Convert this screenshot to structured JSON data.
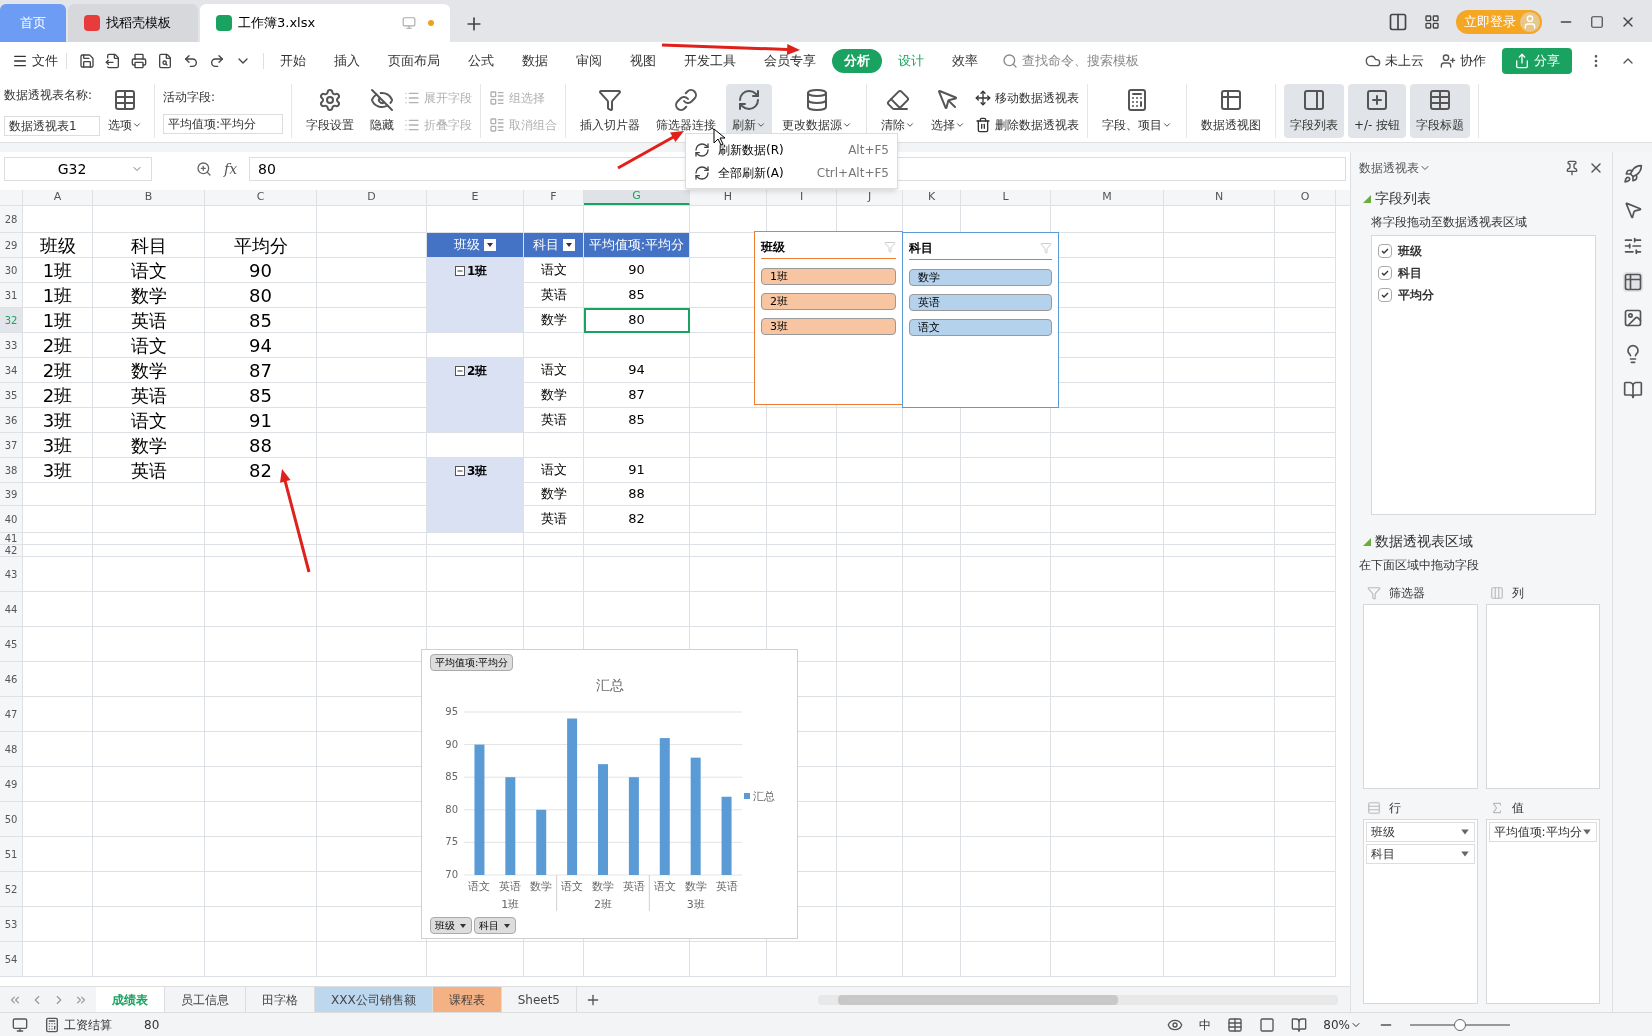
{
  "tabs": [
    {
      "label": "首页",
      "selected": false,
      "kind": "home"
    },
    {
      "label": "找稻壳模板",
      "selected": false,
      "kind": "docer"
    },
    {
      "label": "工作簿3.xlsx",
      "selected": true,
      "kind": "sheet"
    }
  ],
  "title_bar": {
    "login": "立即登录"
  },
  "menu": {
    "file": "文件",
    "items": [
      {
        "label": "开始",
        "selected": false,
        "kind": "normal"
      },
      {
        "label": "插入",
        "selected": false,
        "kind": "normal"
      },
      {
        "label": "页面布局",
        "selected": false,
        "kind": "normal"
      },
      {
        "label": "公式",
        "selected": false,
        "kind": "normal"
      },
      {
        "label": "数据",
        "selected": false,
        "kind": "normal"
      },
      {
        "label": "审阅",
        "selected": false,
        "kind": "normal"
      },
      {
        "label": "视图",
        "selected": false,
        "kind": "normal"
      },
      {
        "label": "开发工具",
        "selected": false,
        "kind": "normal"
      },
      {
        "label": "会员专享",
        "selected": false,
        "kind": "normal"
      },
      {
        "label": "分析",
        "selected": true,
        "kind": "context"
      },
      {
        "label": "设计",
        "selected": false,
        "kind": "context"
      },
      {
        "label": "效率",
        "selected": false,
        "kind": "normal"
      }
    ],
    "search": {
      "placeholder": "查找命令、搜索模板"
    },
    "cloud": "未上云",
    "collab": "协作",
    "share": "分享"
  },
  "ribbon": {
    "name_label": "数据透视表名称:",
    "name_value": "数据透视表1",
    "options": "选项",
    "field_label": "活动字段:",
    "field_value": "平均值项:平均分",
    "groups": [
      {
        "controls": [
          {
            "kind": "large",
            "label": "字段设置",
            "dropdown": false,
            "disabled": false,
            "on": false
          },
          {
            "kind": "large",
            "label": "隐藏",
            "dropdown": false,
            "disabled": false,
            "on": false
          },
          {
            "kind": "stack",
            "items": [
              {
                "label": "展开字段",
                "disabled": true
              },
              {
                "label": "折叠字段",
                "disabled": true
              }
            ]
          }
        ]
      },
      {
        "controls": [
          {
            "kind": "stack",
            "items": [
              {
                "label": "组选择",
                "disabled": true
              },
              {
                "label": "取消组合",
                "disabled": true
              }
            ]
          }
        ]
      },
      {
        "controls": [
          {
            "kind": "large",
            "label": "插入切片器",
            "dropdown": false,
            "disabled": false,
            "on": false
          },
          {
            "kind": "large",
            "label": "筛选器连接",
            "dropdown": false,
            "disabled": false,
            "on": false
          },
          {
            "kind": "large",
            "label": "刷新",
            "dropdown": true,
            "disabled": false,
            "on": true
          },
          {
            "kind": "large",
            "label": "更改数据源",
            "dropdown": true,
            "disabled": false,
            "on": false
          }
        ]
      },
      {
        "controls": [
          {
            "kind": "large",
            "label": "清除",
            "dropdown": true,
            "disabled": false,
            "on": false
          },
          {
            "kind": "large",
            "label": "选择",
            "dropdown": true,
            "disabled": false,
            "on": false
          },
          {
            "kind": "stack",
            "items": [
              {
                "label": "移动数据透视表",
                "disabled": false
              },
              {
                "label": "删除数据透视表",
                "disabled": false
              }
            ]
          }
        ]
      },
      {
        "controls": [
          {
            "kind": "large",
            "label": "字段、项目",
            "dropdown": true,
            "disabled": false,
            "on": false
          }
        ]
      },
      {
        "controls": [
          {
            "kind": "large",
            "label": "数据透视图",
            "dropdown": false,
            "disabled": false,
            "on": false
          }
        ]
      },
      {
        "controls": [
          {
            "kind": "large",
            "label": "字段列表",
            "dropdown": false,
            "disabled": false,
            "on": true
          },
          {
            "kind": "large",
            "label": "+/- 按钮",
            "dropdown": false,
            "disabled": false,
            "on": true
          },
          {
            "kind": "large",
            "label": "字段标题",
            "dropdown": false,
            "disabled": false,
            "on": true
          }
        ]
      }
    ]
  },
  "refresh_menu": [
    {
      "label": "刷新数据(R)",
      "shortcut": "Alt+F5"
    },
    {
      "label": "全部刷新(A)",
      "shortcut": "Ctrl+Alt+F5"
    }
  ],
  "formula_bar": {
    "cell": "G32",
    "fx": "fx",
    "value": "80"
  },
  "columns": [
    {
      "label": "A",
      "selected": false
    },
    {
      "label": "B",
      "selected": false
    },
    {
      "label": "C",
      "selected": false
    },
    {
      "label": "D",
      "selected": false
    },
    {
      "label": "E",
      "selected": false
    },
    {
      "label": "F",
      "selected": false
    },
    {
      "label": "G",
      "selected": true
    },
    {
      "label": "H",
      "selected": false
    },
    {
      "label": "I",
      "selected": false
    },
    {
      "label": "J",
      "selected": false
    },
    {
      "label": "K",
      "selected": false
    },
    {
      "label": "L",
      "selected": false
    },
    {
      "label": "M",
      "selected": false
    },
    {
      "label": "N",
      "selected": false
    },
    {
      "label": "O",
      "selected": false
    }
  ],
  "rows": [
    {
      "label": "28",
      "selected": false
    },
    {
      "label": "29",
      "selected": false
    },
    {
      "label": "30",
      "selected": false
    },
    {
      "label": "31",
      "selected": false
    },
    {
      "label": "32",
      "selected": true
    },
    {
      "label": "33",
      "selected": false
    },
    {
      "label": "34",
      "selected": false
    },
    {
      "label": "35",
      "selected": false
    },
    {
      "label": "36",
      "selected": false
    },
    {
      "label": "37",
      "selected": false
    },
    {
      "label": "38",
      "selected": false
    },
    {
      "label": "39",
      "selected": false
    },
    {
      "label": "40",
      "selected": false
    },
    {
      "label": "41",
      "selected": false
    },
    {
      "label": "42",
      "selected": false
    },
    {
      "label": "43",
      "selected": false
    },
    {
      "label": "44",
      "selected": false
    },
    {
      "label": "45",
      "selected": false
    },
    {
      "label": "46",
      "selected": false
    },
    {
      "label": "47",
      "selected": false
    },
    {
      "label": "48",
      "selected": false
    },
    {
      "label": "49",
      "selected": false
    },
    {
      "label": "50",
      "selected": false
    },
    {
      "label": "51",
      "selected": false
    },
    {
      "label": "52",
      "selected": false
    },
    {
      "label": "53",
      "selected": false
    },
    {
      "label": "54",
      "selected": false
    }
  ],
  "source_table": {
    "header": [
      "班级",
      "科目",
      "平均分"
    ],
    "rows": [
      [
        "1班",
        "语文",
        "90"
      ],
      [
        "1班",
        "数学",
        "80"
      ],
      [
        "1班",
        "英语",
        "85"
      ],
      [
        "2班",
        "语文",
        "94"
      ],
      [
        "2班",
        "数学",
        "87"
      ],
      [
        "2班",
        "英语",
        "85"
      ],
      [
        "3班",
        "语文",
        "91"
      ],
      [
        "3班",
        "数学",
        "88"
      ],
      [
        "3班",
        "英语",
        "82"
      ]
    ]
  },
  "pivot_table": {
    "headers": [
      {
        "label": "班级",
        "filter": true
      },
      {
        "label": "科目",
        "filter": true
      },
      {
        "label": "平均值项:平均分",
        "filter": false
      }
    ],
    "groups": [
      {
        "label": "1班",
        "expanded": true,
        "rows": [
          {
            "subject": "语文",
            "value": "90",
            "selected": false
          },
          {
            "subject": "英语",
            "value": "85",
            "selected": false
          },
          {
            "subject": "数学",
            "value": "80",
            "selected": true
          }
        ]
      },
      {
        "label": "2班",
        "expanded": true,
        "rows": [
          {
            "subject": "语文",
            "value": "94",
            "selected": false
          },
          {
            "subject": "数学",
            "value": "87",
            "selected": false
          },
          {
            "subject": "英语",
            "value": "85",
            "selected": false
          }
        ]
      },
      {
        "label": "3班",
        "expanded": true,
        "rows": [
          {
            "subject": "语文",
            "value": "91",
            "selected": false
          },
          {
            "subject": "数学",
            "value": "88",
            "selected": false
          },
          {
            "subject": "英语",
            "value": "82",
            "selected": false
          }
        ]
      }
    ]
  },
  "slicers": [
    {
      "title": "班级",
      "color": "#ed7d31",
      "items": [
        {
          "label": "1班",
          "selected": true
        },
        {
          "label": "2班",
          "selected": true
        },
        {
          "label": "3班",
          "selected": true
        }
      ]
    },
    {
      "title": "科目",
      "color": "#5b9bd5",
      "items": [
        {
          "label": "数学",
          "selected": true
        },
        {
          "label": "英语",
          "selected": true
        },
        {
          "label": "语文",
          "selected": true
        }
      ]
    }
  ],
  "chart": {
    "value_button": "平均值项:平均分",
    "axis_buttons": [
      "班级",
      "科目"
    ],
    "group_labels": [
      "1班",
      "2班",
      "3班"
    ],
    "chart_data": {
      "type": "bar",
      "title": "汇总",
      "categories": [
        "语文",
        "英语",
        "数学",
        "语文",
        "数学",
        "英语",
        "语文",
        "数学",
        "英语"
      ],
      "series": [
        {
          "name": "汇总",
          "color": "#5b9bd5",
          "values": [
            90,
            85,
            80,
            94,
            87,
            85,
            91,
            88,
            82
          ]
        }
      ],
      "ylim": [
        70,
        95
      ],
      "grid": true,
      "yticks": [
        70,
        75,
        80,
        85,
        90,
        95
      ]
    }
  },
  "sheet_tabs": [
    {
      "label": "成绩表",
      "selected": true
    },
    {
      "label": "员工信息",
      "selected": false
    },
    {
      "label": "田字格",
      "selected": false
    },
    {
      "label": "XXX公司销售额",
      "selected": false,
      "color": "#bdd7ee"
    },
    {
      "label": "课程表",
      "selected": false,
      "color": "#f4b183"
    },
    {
      "label": "Sheet5",
      "selected": false
    }
  ],
  "panel": {
    "title": "数据透视表",
    "fields_title": "字段列表",
    "fields_hint": "将字段拖动至数据透视表区域",
    "fields": [
      {
        "label": "班级",
        "checked": true
      },
      {
        "label": "科目",
        "checked": true
      },
      {
        "label": "平均分",
        "checked": true
      }
    ],
    "areas_title": "数据透视表区域",
    "areas_hint": "在下面区域中拖动字段",
    "areas": [
      {
        "label": "筛选器",
        "kind": "filter"
      },
      {
        "label": "列",
        "kind": "columns"
      },
      {
        "label": "行",
        "kind": "rows",
        "fields": [
          "班级",
          "科目"
        ]
      },
      {
        "label": "值",
        "kind": "values",
        "fields": [
          "平均值项:平均分"
        ]
      }
    ]
  },
  "status_bar": {
    "macro": "工资结算",
    "value": "80",
    "ime": "中",
    "zoom": "80%",
    "zoom_slider": {
      "level": 0.5
    }
  }
}
